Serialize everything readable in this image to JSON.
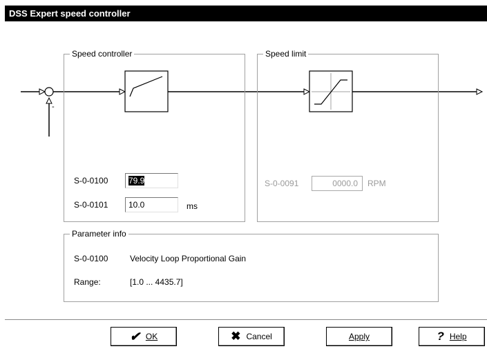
{
  "window": {
    "title": "DSS Expert speed controller"
  },
  "speed_controller": {
    "legend": "Speed controller",
    "params": [
      {
        "code": "S-0-0100",
        "value": "79.9",
        "unit": ""
      },
      {
        "code": "S-0-0101",
        "value": "10.0",
        "unit": "ms"
      }
    ]
  },
  "speed_limit": {
    "legend": "Speed limit",
    "param": {
      "code": "S-0-0091",
      "value": "0000.0",
      "unit": "RPM"
    }
  },
  "parameter_info": {
    "legend": "Parameter info",
    "code": "S-0-0100",
    "description": "Velocity Loop Proportional Gain",
    "range_label": "Range:",
    "range_value": "[1.0 ... 4435.7]"
  },
  "diagram": {
    "summing_sign": "-"
  },
  "buttons": {
    "ok": {
      "label": "OK",
      "icon": "checkmark-icon"
    },
    "cancel": {
      "label": "Cancel",
      "icon": "x-icon"
    },
    "apply": {
      "label": "Apply"
    },
    "help": {
      "label": "Help",
      "icon": "question-icon"
    }
  }
}
